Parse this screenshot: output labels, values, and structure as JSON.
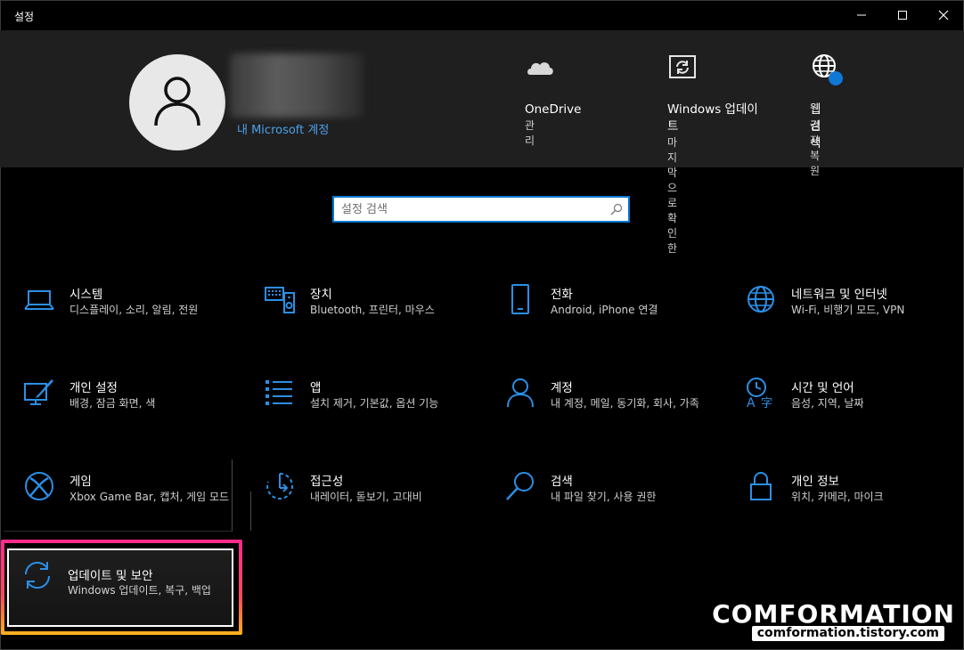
{
  "window": {
    "title": "설정"
  },
  "header": {
    "account_link": "내 Microsoft 계정",
    "items": [
      {
        "title": "OneDrive",
        "subtitle": "관리",
        "icon": "cloud-icon"
      },
      {
        "title": "Windows 업데이트",
        "subtitle": "마지막으로 확인한",
        "icon": "update-icon"
      },
      {
        "title": "웹 검색",
        "subtitle": "권장 복원",
        "icon": "globe-icon"
      }
    ]
  },
  "search": {
    "placeholder": "설정 검색",
    "value": ""
  },
  "categories": [
    {
      "title": "시스템",
      "desc": "디스플레이, 소리, 알림, 전원",
      "icon": "laptop-icon"
    },
    {
      "title": "장치",
      "desc": "Bluetooth, 프린터, 마우스",
      "icon": "keyboard-speaker-icon"
    },
    {
      "title": "전화",
      "desc": "Android, iPhone 연결",
      "icon": "phone-icon"
    },
    {
      "title": "네트워크 및 인터넷",
      "desc": "Wi-Fi, 비행기 모드, VPN",
      "icon": "globe-icon"
    },
    {
      "title": "개인 설정",
      "desc": "배경, 잠금 화면, 색",
      "icon": "paint-icon"
    },
    {
      "title": "앱",
      "desc": "설치 제거, 기본값, 옵션 기능",
      "icon": "apps-list-icon"
    },
    {
      "title": "계정",
      "desc": "내 계정, 메일, 동기화, 회사, 가족",
      "icon": "person-icon"
    },
    {
      "title": "시간 및 언어",
      "desc": "음성, 지역, 날짜",
      "icon": "time-language-icon"
    },
    {
      "title": "게임",
      "desc": "Xbox Game Bar, 캡처, 게임 모드",
      "icon": "xbox-icon"
    },
    {
      "title": "접근성",
      "desc": "내레이터, 돋보기, 고대비",
      "icon": "accessibility-icon"
    },
    {
      "title": "검색",
      "desc": "내 파일 찾기, 사용 권한",
      "icon": "search-icon"
    },
    {
      "title": "개인 정보",
      "desc": "위치, 카메라, 마이크",
      "icon": "lock-icon"
    },
    {
      "title": "업데이트 및 보안",
      "desc": "Windows 업데이트, 복구, 백업",
      "icon": "sync-icon"
    }
  ],
  "watermark": {
    "title": "COMFORMATION",
    "subtitle": "comformation.tistory.com"
  },
  "colors": {
    "accent": "#0078d4",
    "icon_blue": "#2b8fe6",
    "link": "#4ca0e8",
    "highlight": "#ff2a8c"
  }
}
